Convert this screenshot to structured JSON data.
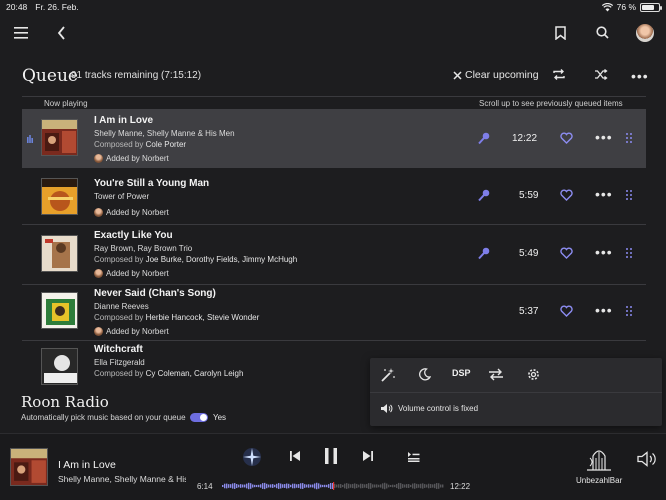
{
  "statusbar": {
    "time": "20:48",
    "date": "Fr. 26. Feb.",
    "battery": "76 %",
    "battery_level": 0.76
  },
  "header": {
    "title": "Queue",
    "tracks_remaining": "91 tracks remaining (7:15:12)",
    "clear_label": "Clear upcoming"
  },
  "labels": {
    "now_playing": "Now playing",
    "scroll_hint": "Scroll up to see previously queued items"
  },
  "tracks": [
    {
      "title": "I Am in Love",
      "artist": "Shelly Manne, Shelly Manne & His Men",
      "composed_prefix": "Composed by",
      "composers": "Cole Porter",
      "added": "Added by Norbert",
      "duration": "12:22",
      "current": true
    },
    {
      "title": "You're Still a Young Man",
      "artist": "Tower of Power",
      "composed_prefix": "",
      "composers": "",
      "added": "Added by Norbert",
      "duration": "5:59"
    },
    {
      "title": "Exactly Like You",
      "artist": "Ray Brown, Ray Brown Trio",
      "composed_prefix": "Composed by",
      "composers": "Joe Burke, Dorothy Fields, Jimmy McHugh",
      "added": "Added by Norbert",
      "duration": "5:49"
    },
    {
      "title": "Never Said (Chan's Song)",
      "artist": "Dianne Reeves",
      "composed_prefix": "Composed by",
      "composers": "Herbie Hancock, Stevie Wonder",
      "added": "Added by Norbert",
      "duration": "5:37"
    },
    {
      "title": "Witchcraft",
      "artist": "Ella Fitzgerald",
      "composed_prefix": "Composed by",
      "composers": "Cy Coleman, Carolyn Leigh",
      "added": "",
      "duration": ""
    }
  ],
  "radio": {
    "title": "Roon Radio",
    "subtitle": "Automatically pick music based on your queue",
    "toggle_label": "Yes",
    "enabled": true
  },
  "popup": {
    "dsp_label": "DSP",
    "volume_text": "Volume control is fixed"
  },
  "player": {
    "title": "I Am in Love",
    "artist": "Shelly Manne, Shelly Manne & His Men",
    "elapsed": "6:14",
    "total": "12:22",
    "progress": 0.5,
    "zone": "UnbezahlBar"
  },
  "colors": {
    "accent": "#8c8cf0",
    "background": "#1d1d1f",
    "current_row": "#3f3f43"
  },
  "icons": [
    "menu-icon",
    "back-icon",
    "bookmark-icon",
    "search-icon",
    "user-avatar",
    "close-icon",
    "repeat-icon",
    "shuffle-icon",
    "more-icon",
    "microphone-icon",
    "heart-icon",
    "drag-handle-icon",
    "magic-wand-icon",
    "moon-icon",
    "swap-icon",
    "gear-icon",
    "speaker-icon",
    "radio-star-icon",
    "previous-icon",
    "pause-icon",
    "next-icon",
    "queue-icon",
    "zone-icon",
    "volume-icon"
  ]
}
